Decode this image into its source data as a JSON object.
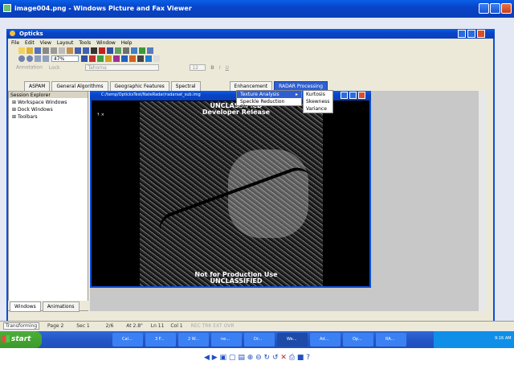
{
  "viewer": {
    "title": "image004.png - Windows Picture and Fax Viewer"
  },
  "app": {
    "title": "Opticks",
    "menu": [
      "File",
      "Edit",
      "View",
      "Layout",
      "Tools",
      "Window",
      "Help"
    ],
    "zoom": "47%",
    "font": "Tahoma",
    "font_size": "12",
    "annotation": "Annotation",
    "lock": "Lock",
    "bold": "B",
    "italic": "I",
    "underline": "U"
  },
  "tabs": [
    "ASPAM",
    "General Algorithms",
    "Geographic Features",
    "Spectral",
    "Enhancement",
    "RADAR Processing"
  ],
  "session": {
    "title": "Session Explorer",
    "items": [
      "Workspace Windows",
      "Dock Windows",
      "Toolbars"
    ],
    "bottom_tabs": [
      "Windows",
      "Animations"
    ]
  },
  "image_window": {
    "path": "C:/temp/OpticksTest/NateRadar/radarsat_sub.img",
    "top_text": [
      "UNCLASSIFIED",
      "Developer Release"
    ],
    "bottom_text": [
      "Not for Production Use",
      "UNCLASSIFIED"
    ]
  },
  "radar_menu": {
    "items": [
      "Texture Analysis",
      "Speckle Reduction Filters"
    ],
    "submenu": [
      "Kurtosis",
      "Skewness",
      "Variance"
    ]
  },
  "status": {
    "left": "Transforming",
    "page": "Page 2",
    "sec": "Sec 1",
    "pages": "2/6",
    "at": "At 2.8\"",
    "ln": "Ln 11",
    "col": "Col 1",
    "flags": "REC TRK EXT OVR"
  },
  "taskbar": {
    "start": "start",
    "items": [
      "Cal...",
      "3 F...",
      "2 W...",
      "ne...",
      "Dr...",
      "We...",
      "Ad...",
      "Op...",
      "RA..."
    ],
    "time": "9:16 AM"
  },
  "colors": {
    "xp_blue": "#0a4fd8",
    "start_green": "#3c9a2a",
    "radar_menu_blue": "#2f5fd0"
  }
}
